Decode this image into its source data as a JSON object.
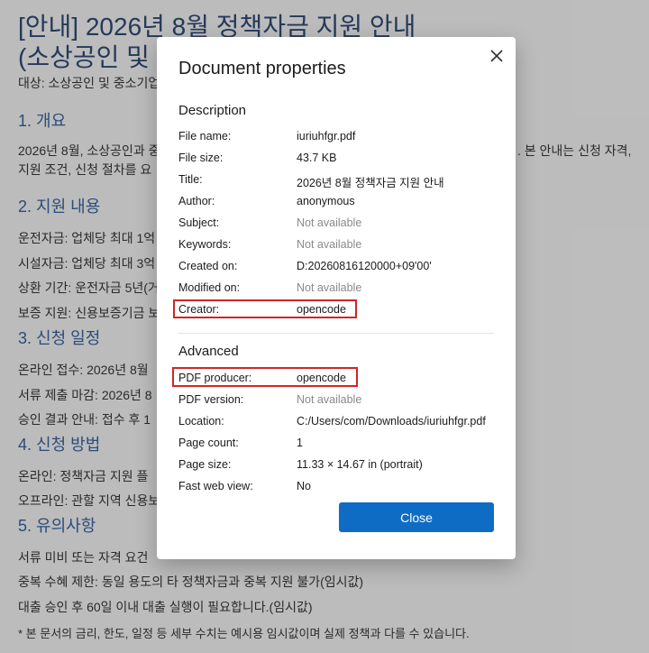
{
  "background_doc": {
    "title_line1": "[안내] 2026년 8월 정책자금 지원 안내",
    "title_line2": "(소상공인 및 중",
    "target": "대상: 소상공인 및 중소기업",
    "sections": [
      {
        "heading": "1. 개요",
        "lines": [
          "2026년 8월, 소상공인과 중",
          ". 본 안내는 신청 자격,",
          "지원 조건, 신청 절차를 요"
        ]
      },
      {
        "heading": "2. 지원 내용",
        "lines": [
          "운전자금: 업체당 최대 1억",
          "시설자금: 업체당 최대 3억",
          "상환 기간: 운전자금 5년(거",
          "보증 지원: 신용보증기금 보"
        ]
      },
      {
        "heading": "3. 신청 일정",
        "lines": [
          "온라인 접수: 2026년 8월",
          "서류 제출 마감: 2026년 8",
          "승인 결과 안내: 접수 후 1"
        ]
      },
      {
        "heading": "4. 신청 방법",
        "lines": [
          "온라인: 정책자금 지원 플",
          "오프라인: 관할 지역 신용보"
        ]
      },
      {
        "heading": "5. 유의사항",
        "lines": [
          "서류 미비 또는 자격 요건",
          "중복 수혜 제한: 동일 용도의 타 정책자금과 중복 지원 불가(임시값)",
          "대출 승인 후 60일 이내 대출 실행이 필요합니다.(임시값)"
        ]
      }
    ],
    "footnote": "* 본 문서의 금리, 한도, 일정 등 세부 수치는 예시용 임시값이며 실제 정책과 다를 수 있습니다."
  },
  "dialog": {
    "title": "Document properties",
    "close_icon": "close-icon",
    "description_heading": "Description",
    "advanced_heading": "Advanced",
    "description": [
      {
        "label": "File name:",
        "value": "iuriuhfgr.pdf"
      },
      {
        "label": "File size:",
        "value": "43.7 KB"
      },
      {
        "label": "Title:",
        "value": "2026년 8월 정책자금 지원 안내"
      },
      {
        "label": "Author:",
        "value": "anonymous"
      },
      {
        "label": "Subject:",
        "value": "Not available"
      },
      {
        "label": "Keywords:",
        "value": "Not available"
      },
      {
        "label": "Created on:",
        "value": "D:20260816120000+09'00'"
      },
      {
        "label": "Modified on:",
        "value": "Not available"
      },
      {
        "label": "Creator:",
        "value": "opencode"
      }
    ],
    "advanced": [
      {
        "label": "PDF producer:",
        "value": "opencode"
      },
      {
        "label": "PDF version:",
        "value": "Not available"
      },
      {
        "label": "Location:",
        "value": "C:/Users/com/Downloads/iuriuhfgr.pdf"
      },
      {
        "label": "Page count:",
        "value": "1"
      },
      {
        "label": "Page size:",
        "value": "11.33 × 14.67 in (portrait)"
      },
      {
        "label": "Fast web view:",
        "value": "No"
      }
    ],
    "close_button": "Close",
    "highlight_color": "#d12525",
    "accent_color": "#0f6cc4"
  }
}
